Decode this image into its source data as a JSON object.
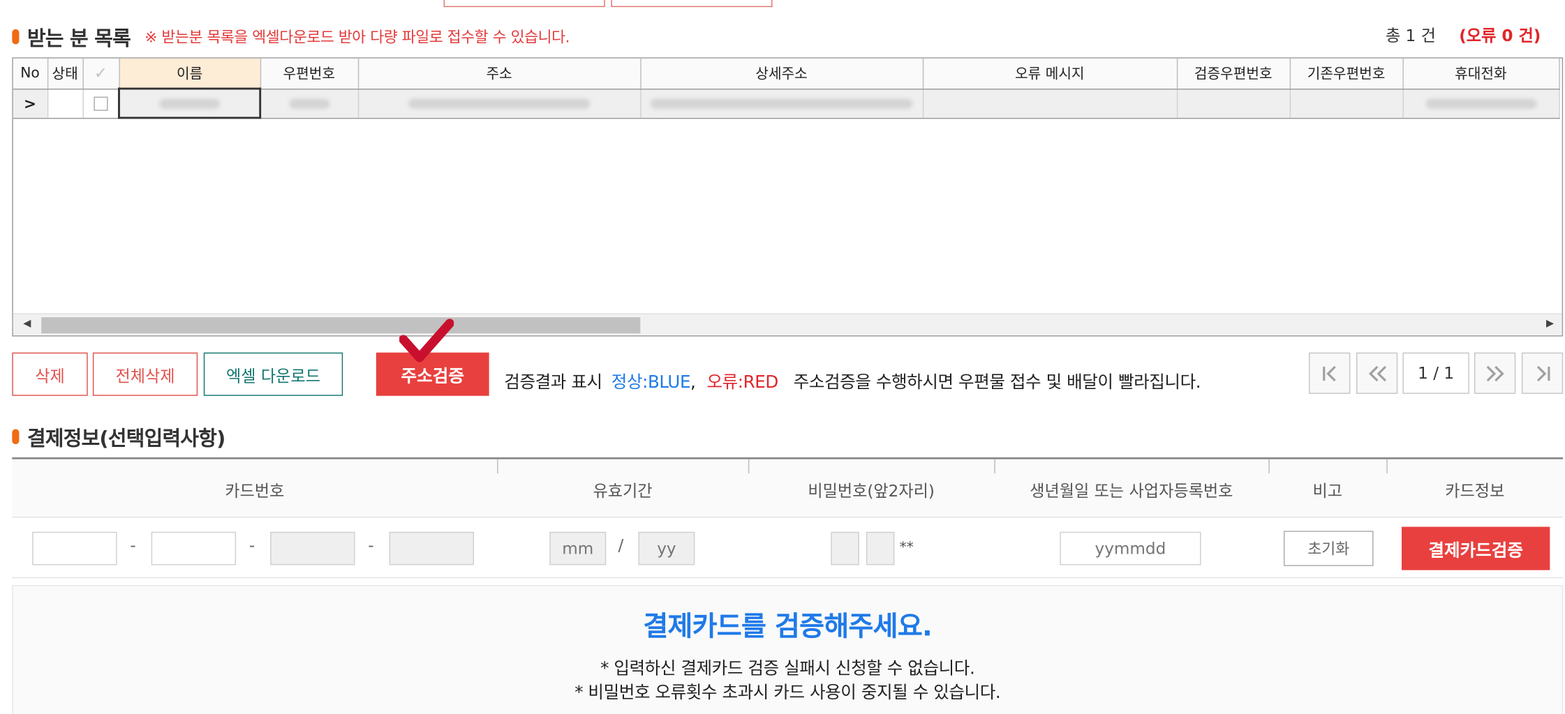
{
  "recipients": {
    "title": "받는 분 목록",
    "note": "※ 받는분 목록을 엑셀다운로드 받아 다량 파일로 접수할 수 있습니다.",
    "total": "총 1 건",
    "errors": "(오류 0 건)",
    "columns": [
      "No",
      "상태",
      "✓",
      "이름",
      "우편번호",
      "주소",
      "상세주소",
      "오류 메시지",
      "검증우편번호",
      "기존우편번호",
      "휴대전화"
    ],
    "row_marker": ">"
  },
  "actions": {
    "delete": "삭제",
    "delete_all": "전체삭제",
    "excel_download": "엑셀 다운로드",
    "verify_address": "주소검증",
    "result_label": "검증결과 표시",
    "normal": "정상:BLUE",
    "comma": ",",
    "error": "오류:RED",
    "hint": "주소검증을 수행하시면 우편물 접수 및 배달이 빨라집니다."
  },
  "pagination": {
    "page": "1 / 1",
    "first": "first-page",
    "prev": "prev-page",
    "next": "next-page",
    "last": "last-page"
  },
  "payment": {
    "title": "결제정보(선택입력사항)",
    "headers": {
      "card_number": "카드번호",
      "expiry": "유효기간",
      "password": "비밀번호(앞2자리)",
      "birth": "생년월일 또는 사업자등록번호",
      "remarks": "비고",
      "card_info": "카드정보"
    },
    "dash": "-",
    "slash": "/",
    "mm_placeholder": "mm",
    "yy_placeholder": "yy",
    "pw_mask": "**",
    "birth_placeholder": "yymmdd",
    "reset": "초기화",
    "verify_card": "결제카드검증"
  },
  "notice": {
    "heading": "결제카드를 검증해주세요.",
    "line1": "* 입력하신 결제카드 검증 실패시 신청할 수 없습니다.",
    "line2": "* 비밀번호 오류횟수 초과시 카드 사용이 중지될 수 있습니다."
  },
  "colors": {
    "accent_red": "#e8403f",
    "bullet_orange": "#f06b13",
    "blue": "#1f7ae8",
    "teal": "#14766f"
  }
}
